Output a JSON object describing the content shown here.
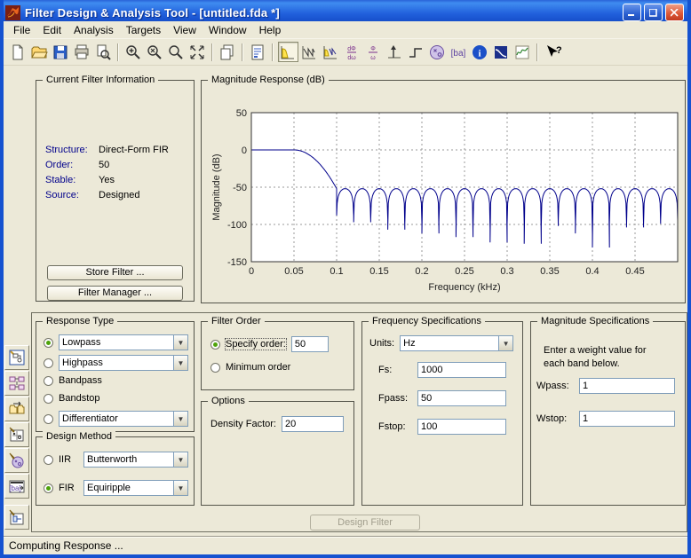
{
  "window": {
    "title": "Filter Design & Analysis Tool -  [untitled.fda *]",
    "app_icon": "matlab-logo",
    "controls": {
      "minimize": "_",
      "maximize": "□",
      "close": "✕"
    }
  },
  "menu": {
    "items": [
      "File",
      "Edit",
      "Analysis",
      "Targets",
      "View",
      "Window",
      "Help"
    ]
  },
  "toolbar": {
    "items": [
      {
        "name": "new-file-icon"
      },
      {
        "name": "open-file-icon"
      },
      {
        "name": "save-icon"
      },
      {
        "name": "print-icon"
      },
      {
        "name": "print-preview-icon"
      },
      {
        "sep": true
      },
      {
        "name": "zoom-in-icon"
      },
      {
        "name": "zoom-out-icon"
      },
      {
        "name": "zoom-restore-icon"
      },
      {
        "name": "full-view-icon"
      },
      {
        "sep": true
      },
      {
        "name": "print-to-figure-icon"
      },
      {
        "sep": true
      },
      {
        "name": "filter-specifications-icon"
      },
      {
        "sep": true
      },
      {
        "name": "magnitude-response-icon",
        "selected": true
      },
      {
        "name": "phase-response-icon"
      },
      {
        "name": "magnitude-phase-icon"
      },
      {
        "name": "group-delay-icon"
      },
      {
        "name": "phase-delay-icon"
      },
      {
        "name": "impulse-response-icon"
      },
      {
        "name": "step-response-icon"
      },
      {
        "name": "pole-zero-icon"
      },
      {
        "name": "filter-coefficients-icon"
      },
      {
        "name": "filter-information-icon"
      },
      {
        "name": "magnitude-estimate-icon"
      },
      {
        "name": "noise-psd-icon"
      },
      {
        "sep": true
      },
      {
        "name": "help-icon"
      }
    ]
  },
  "sidebar": {
    "items": [
      {
        "name": "multirate-filter-icon"
      },
      {
        "name": "transform-filter-icon"
      },
      {
        "name": "import-filter-icon"
      },
      {
        "name": "pole-zero-editor-icon"
      },
      {
        "name": "quantization-icon"
      },
      {
        "name": "realize-model-icon"
      },
      {
        "name": "design-filter-icon",
        "gap": true
      }
    ]
  },
  "current_filter_info": {
    "title": "Current Filter Information",
    "rows": [
      {
        "label": "Structure:",
        "value": "Direct-Form FIR"
      },
      {
        "label": "Order:",
        "value": "50"
      },
      {
        "label": "Stable:",
        "value": "Yes"
      },
      {
        "label": "Source:",
        "value": "Designed"
      }
    ],
    "buttons": [
      {
        "label": "Store Filter ..."
      },
      {
        "label": "Filter Manager ..."
      }
    ]
  },
  "magnitude_response_panel": {
    "title": "Magnitude Response (dB)"
  },
  "chart_data": {
    "type": "line",
    "title": "Magnitude Response (dB)",
    "xlabel": "Frequency (kHz)",
    "ylabel": "Magnitude (dB)",
    "xlim": [
      0,
      0.5
    ],
    "ylim": [
      -150,
      50
    ],
    "xticks": [
      "0",
      "0.05",
      "0.1",
      "0.15",
      "0.2",
      "0.25",
      "0.3",
      "0.35",
      "0.4",
      "0.45"
    ],
    "xtick_values": [
      0,
      0.05,
      0.1,
      0.15,
      0.2,
      0.25,
      0.3,
      0.35,
      0.4,
      0.45
    ],
    "yticks": [
      "50",
      "0",
      "-50",
      "-100",
      "-150"
    ],
    "ytick_values": [
      50,
      0,
      -50,
      -100,
      -150
    ],
    "grid": true,
    "line_color": "#00008B",
    "response": {
      "description": "Lowpass equiripple FIR order 50, Fs=1000 Hz, Fpass=50 Hz (0.05 kHz), Fstop=100 Hz (0.1 kHz); passband at 0 dB, stopband equiripple lobes peaking near -52 dB with nulls of varying depth",
      "passband_db": 0,
      "passband_flat_end_khz": 0.05,
      "stopband_start_khz": 0.1,
      "stopband_peak_db": -52,
      "lobe_width_khz": 0.02,
      "n_lobes": 20,
      "null_depths_db": [
        -88,
        -97,
        -93,
        -107,
        -99,
        -112,
        -96,
        -117,
        -106,
        -124,
        -98,
        -126,
        -102,
        -95,
        -112,
        -131,
        -97,
        -104,
        -99,
        -95
      ]
    }
  },
  "response_type": {
    "title": "Response Type",
    "options": [
      {
        "label": "Lowpass",
        "selected": true,
        "dropdown": true
      },
      {
        "label": "Highpass",
        "selected": false,
        "dropdown": true
      },
      {
        "label": "Bandpass",
        "selected": false,
        "dropdown": false
      },
      {
        "label": "Bandstop",
        "selected": false,
        "dropdown": false
      },
      {
        "label": "Differentiator",
        "selected": false,
        "dropdown": true
      }
    ]
  },
  "design_method": {
    "title": "Design Method",
    "options": [
      {
        "label": "IIR",
        "selected": false,
        "dropdown_value": "Butterworth"
      },
      {
        "label": "FIR",
        "selected": true,
        "dropdown_value": "Equiripple"
      }
    ]
  },
  "filter_order": {
    "title": "Filter Order",
    "specify_label": "Specify order:",
    "specify_value": "50",
    "specify_selected": true,
    "minimum_label": "Minimum order",
    "minimum_selected": false
  },
  "options_panel": {
    "title": "Options",
    "density_label": "Density Factor:",
    "density_value": "20"
  },
  "frequency_specs": {
    "title": "Frequency Specifications",
    "units_label": "Units:",
    "units_value": "Hz",
    "fields": [
      {
        "label": "Fs:",
        "value": "1000"
      },
      {
        "label": "Fpass:",
        "value": "50"
      },
      {
        "label": "Fstop:",
        "value": "100"
      }
    ]
  },
  "magnitude_specs": {
    "title": "Magnitude Specifications",
    "note_line1": "Enter a weight value for",
    "note_line2": "each band below.",
    "fields": [
      {
        "label": "Wpass:",
        "value": "1"
      },
      {
        "label": "Wstop:",
        "value": "1"
      }
    ]
  },
  "design_button": {
    "label": "Design Filter",
    "enabled": false
  },
  "status_bar": {
    "text": "Computing Response ..."
  },
  "colors": {
    "background": "#ECE9D8",
    "titlebar_blue": "#2160dc",
    "curve_navy": "#00008B",
    "label_blue": "#00008B",
    "field_border": "#7F9DB9",
    "radio_green": "#4ea30a"
  }
}
